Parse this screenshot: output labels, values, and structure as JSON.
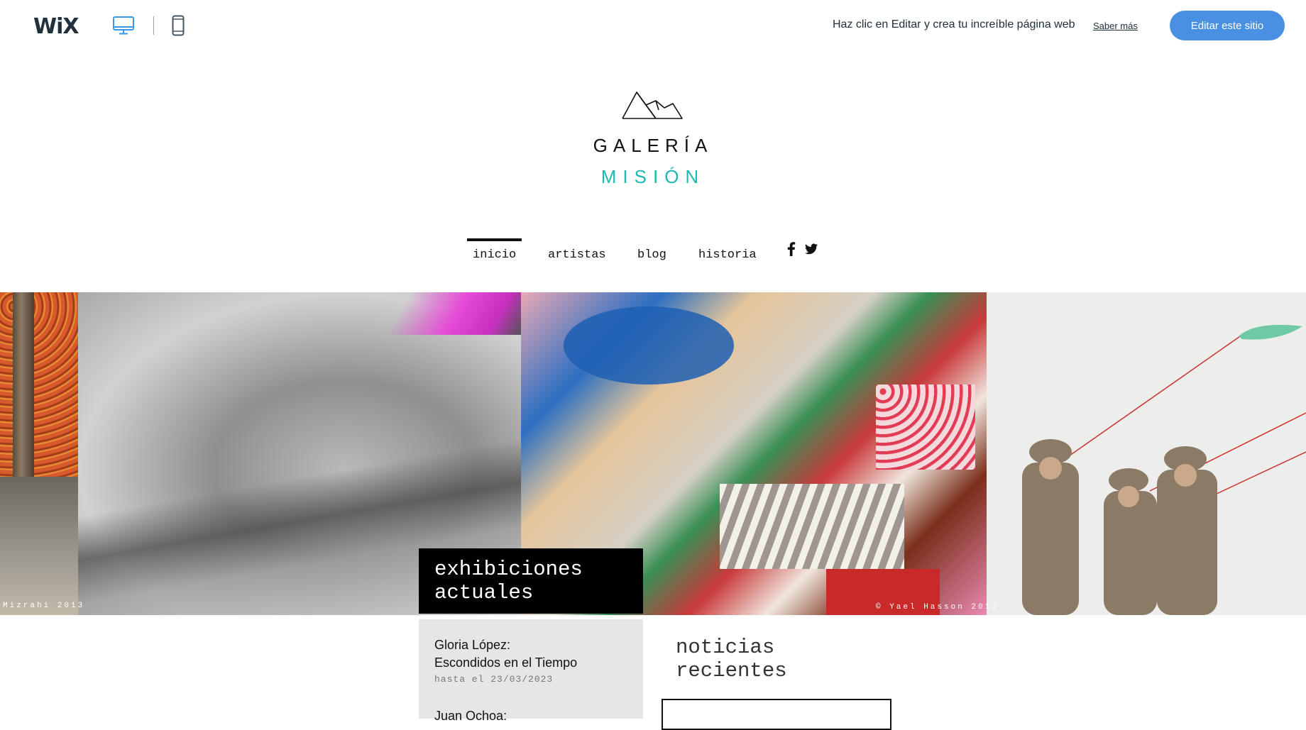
{
  "wix_bar": {
    "logo": "WiX",
    "message": "Haz clic en Editar y crea tu increíble página web",
    "learn_more": "Saber más",
    "edit_button": "Editar este sitio",
    "accent_color": "#4a90e2"
  },
  "site": {
    "logo_line1": "GALERÍA",
    "logo_line2": "MISIÓN",
    "brand_color": "#1fb8b2"
  },
  "nav": {
    "items": [
      {
        "label": "inicio",
        "active": true
      },
      {
        "label": "artistas",
        "active": false
      },
      {
        "label": "blog",
        "active": false
      },
      {
        "label": "historia",
        "active": false
      }
    ],
    "social": [
      "facebook-icon",
      "twitter-icon"
    ]
  },
  "hero": {
    "credit_left": "Mizrahi 2013",
    "credit_right": "© Yael Hasson 2013"
  },
  "exhibitions": {
    "title_line1": "exhibiciones",
    "title_line2": "actuales",
    "items": [
      {
        "name_line1": "Gloria López:",
        "name_line2": "Escondidos en el Tiempo",
        "date": "hasta el 23/03/2023"
      },
      {
        "name_line1": "Juan Ochoa:"
      }
    ]
  },
  "news": {
    "title_line1": "noticias",
    "title_line2": "recientes"
  }
}
